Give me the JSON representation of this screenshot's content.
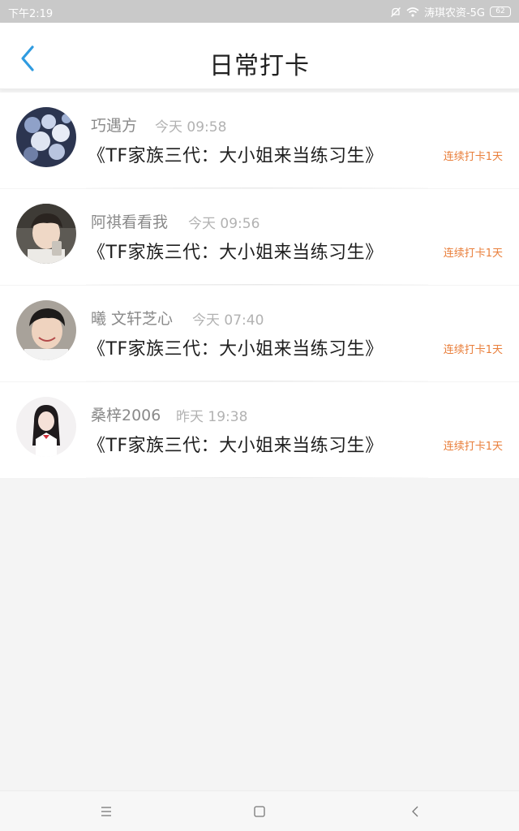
{
  "status_bar": {
    "time": "下午2:19",
    "carrier": "涛琪农资-5G",
    "battery": "62",
    "icons": [
      "bell-off-icon",
      "wifi-icon",
      "battery-icon"
    ]
  },
  "header": {
    "title": "日常打卡",
    "back_icon": "chevron-left-icon",
    "accent_color": "#2f9be0"
  },
  "checkins": [
    {
      "name": "巧遇方",
      "time": "今天 09:58",
      "book": "《TF家族三代：大小姐来当练习生》",
      "streak": "连续打卡1天"
    },
    {
      "name": "阿祺看看我",
      "time": "今天 09:56",
      "book": "《TF家族三代：大小姐来当练习生》",
      "streak": "连续打卡1天"
    },
    {
      "name": "曦 文轩芝心",
      "time": "今天 07:40",
      "book": "《TF家族三代：大小姐来当练习生》",
      "streak": "连续打卡1天"
    },
    {
      "name": "桑梓2006",
      "time": "昨天 19:38",
      "book": "《TF家族三代：大小姐来当练习生》",
      "streak": "连续打卡1天"
    }
  ],
  "colors": {
    "streak": "#e97e3a",
    "name": "#8a8a8a",
    "time": "#b2b2b2"
  },
  "nav_bar": {
    "icons": [
      "menu-icon",
      "home-square-icon",
      "back-triangle-icon"
    ]
  }
}
